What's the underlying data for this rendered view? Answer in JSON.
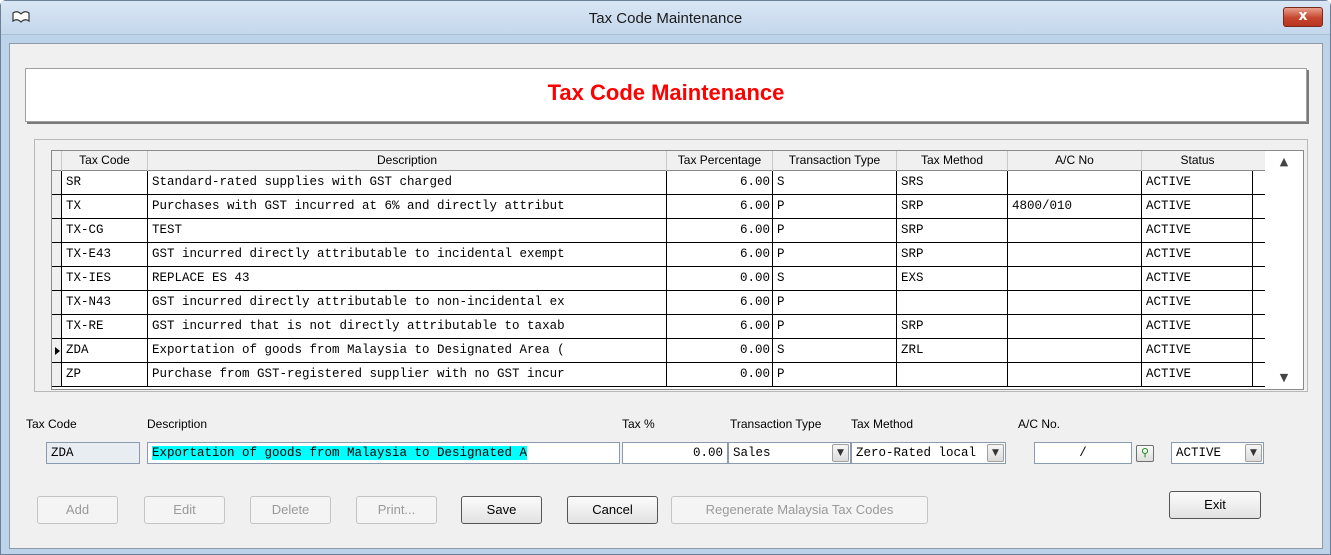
{
  "window": {
    "title": "Tax Code Maintenance",
    "close_label": "x"
  },
  "header": {
    "title": "Tax Code Maintenance"
  },
  "grid": {
    "columns": [
      "Tax Code",
      "Description",
      "Tax Percentage",
      "Transaction Type",
      "Tax Method",
      "A/C No",
      "Status"
    ],
    "rows": [
      {
        "code": "SR",
        "desc": "Standard-rated supplies with GST charged",
        "pct": "6.00",
        "type": "S",
        "method": "SRS",
        "acno": "",
        "status": "ACTIVE"
      },
      {
        "code": "TX",
        "desc": "Purchases with GST incurred at 6% and directly attribut",
        "pct": "6.00",
        "type": "P",
        "method": "SRP",
        "acno": "4800/010",
        "status": "ACTIVE"
      },
      {
        "code": "TX-CG",
        "desc": "TEST",
        "pct": "6.00",
        "type": "P",
        "method": "SRP",
        "acno": "",
        "status": "ACTIVE"
      },
      {
        "code": "TX-E43",
        "desc": "GST incurred directly attributable to incidental exempt",
        "pct": "6.00",
        "type": "P",
        "method": "SRP",
        "acno": "",
        "status": "ACTIVE"
      },
      {
        "code": "TX-IES",
        "desc": "REPLACE ES 43",
        "pct": "0.00",
        "type": "S",
        "method": "EXS",
        "acno": "",
        "status": "ACTIVE"
      },
      {
        "code": "TX-N43",
        "desc": "GST incurred directly attributable to non-incidental ex",
        "pct": "6.00",
        "type": "P",
        "method": "",
        "acno": "",
        "status": "ACTIVE"
      },
      {
        "code": "TX-RE",
        "desc": "GST incurred that is not directly attributable to taxab",
        "pct": "6.00",
        "type": "P",
        "method": "SRP",
        "acno": "",
        "status": "ACTIVE"
      },
      {
        "code": "ZDA",
        "desc": "Exportation of goods from Malaysia to Designated Area (",
        "pct": "0.00",
        "type": "S",
        "method": "ZRL",
        "acno": "",
        "status": "ACTIVE"
      },
      {
        "code": "ZP",
        "desc": "Purchase from GST-registered supplier with no GST incur",
        "pct": "0.00",
        "type": "P",
        "method": "",
        "acno": "",
        "status": "ACTIVE"
      }
    ]
  },
  "form": {
    "labels": {
      "tax_code": "Tax Code",
      "description": "Description",
      "tax_pct": "Tax %",
      "transaction_type": "Transaction Type",
      "tax_method": "Tax Method",
      "ac_no": "A/C No."
    },
    "values": {
      "tax_code": "ZDA",
      "description": "Exportation of goods from Malaysia to Designated A",
      "tax_pct": "0.00",
      "transaction_type": "Sales",
      "tax_method": "Zero-Rated local",
      "ac_no": "/",
      "status": "ACTIVE"
    }
  },
  "buttons": {
    "add": "Add",
    "edit": "Edit",
    "delete": "Delete",
    "print": "Print...",
    "save": "Save",
    "cancel": "Cancel",
    "regenerate": "Regenerate Malaysia Tax Codes",
    "exit": "Exit"
  },
  "colors": {
    "header_title": "#ff0000",
    "selection_highlight": "#00ffff"
  }
}
